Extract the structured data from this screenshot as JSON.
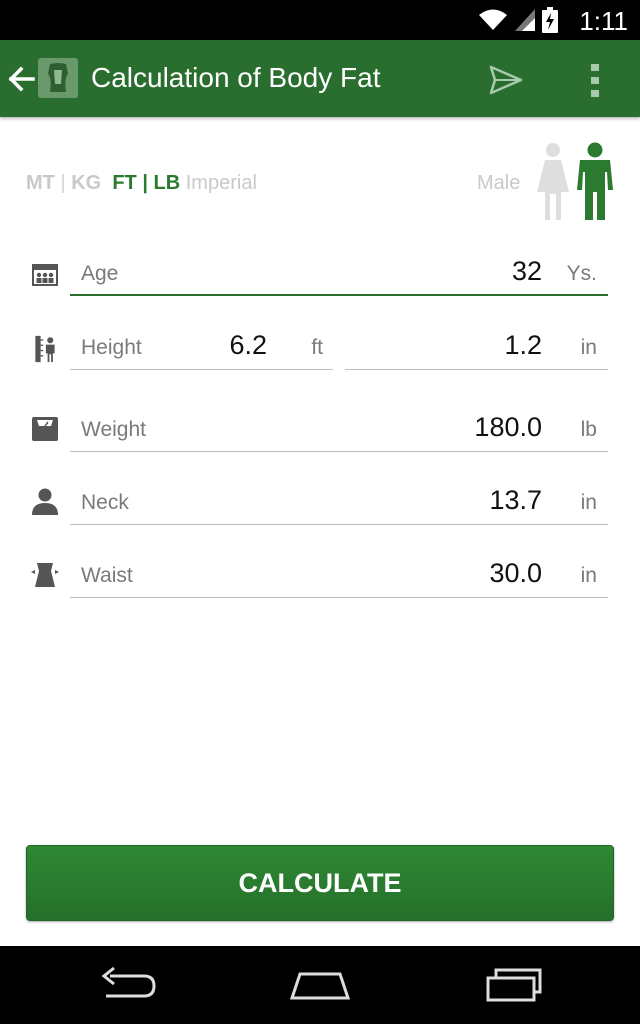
{
  "status_bar": {
    "time": "1:11"
  },
  "app_bar": {
    "title": "Calculation of Body Fat"
  },
  "units": {
    "metric_label": "MT",
    "metric_sep": "|",
    "metric_weight": "KG",
    "imperial_length": "FT",
    "imperial_sep": "|",
    "imperial_weight": "LB",
    "imperial_word": "Imperial",
    "selected": "FT | LB"
  },
  "gender": {
    "label": "Male",
    "selected": "male"
  },
  "fields": {
    "age": {
      "label": "Age",
      "value": "32",
      "unit": "Ys."
    },
    "height_ft": {
      "label": "Height",
      "value": "6.2",
      "unit": "ft"
    },
    "height_in": {
      "value": "1.2",
      "unit": "in"
    },
    "weight": {
      "label": "Weight",
      "value": "180.0",
      "unit": "lb"
    },
    "neck": {
      "label": "Neck",
      "value": "13.7",
      "unit": "in"
    },
    "waist": {
      "label": "Waist",
      "value": "30.0",
      "unit": "in"
    }
  },
  "calculate_button": {
    "label": "CALCULATE"
  },
  "colors": {
    "primary": "#2a6e2f",
    "accent": "#2b7a30",
    "button": "#2e8834"
  },
  "icons": [
    "wifi-icon",
    "signal-icon",
    "battery-charging-icon",
    "back-arrow-icon",
    "body-logo-icon",
    "send-icon",
    "overflow-menu-icon",
    "female-figure-icon",
    "male-figure-icon",
    "calendar-people-icon",
    "height-ruler-icon",
    "scale-icon",
    "person-bust-icon",
    "waist-icon",
    "nav-back-icon",
    "nav-home-icon",
    "nav-recents-icon"
  ]
}
